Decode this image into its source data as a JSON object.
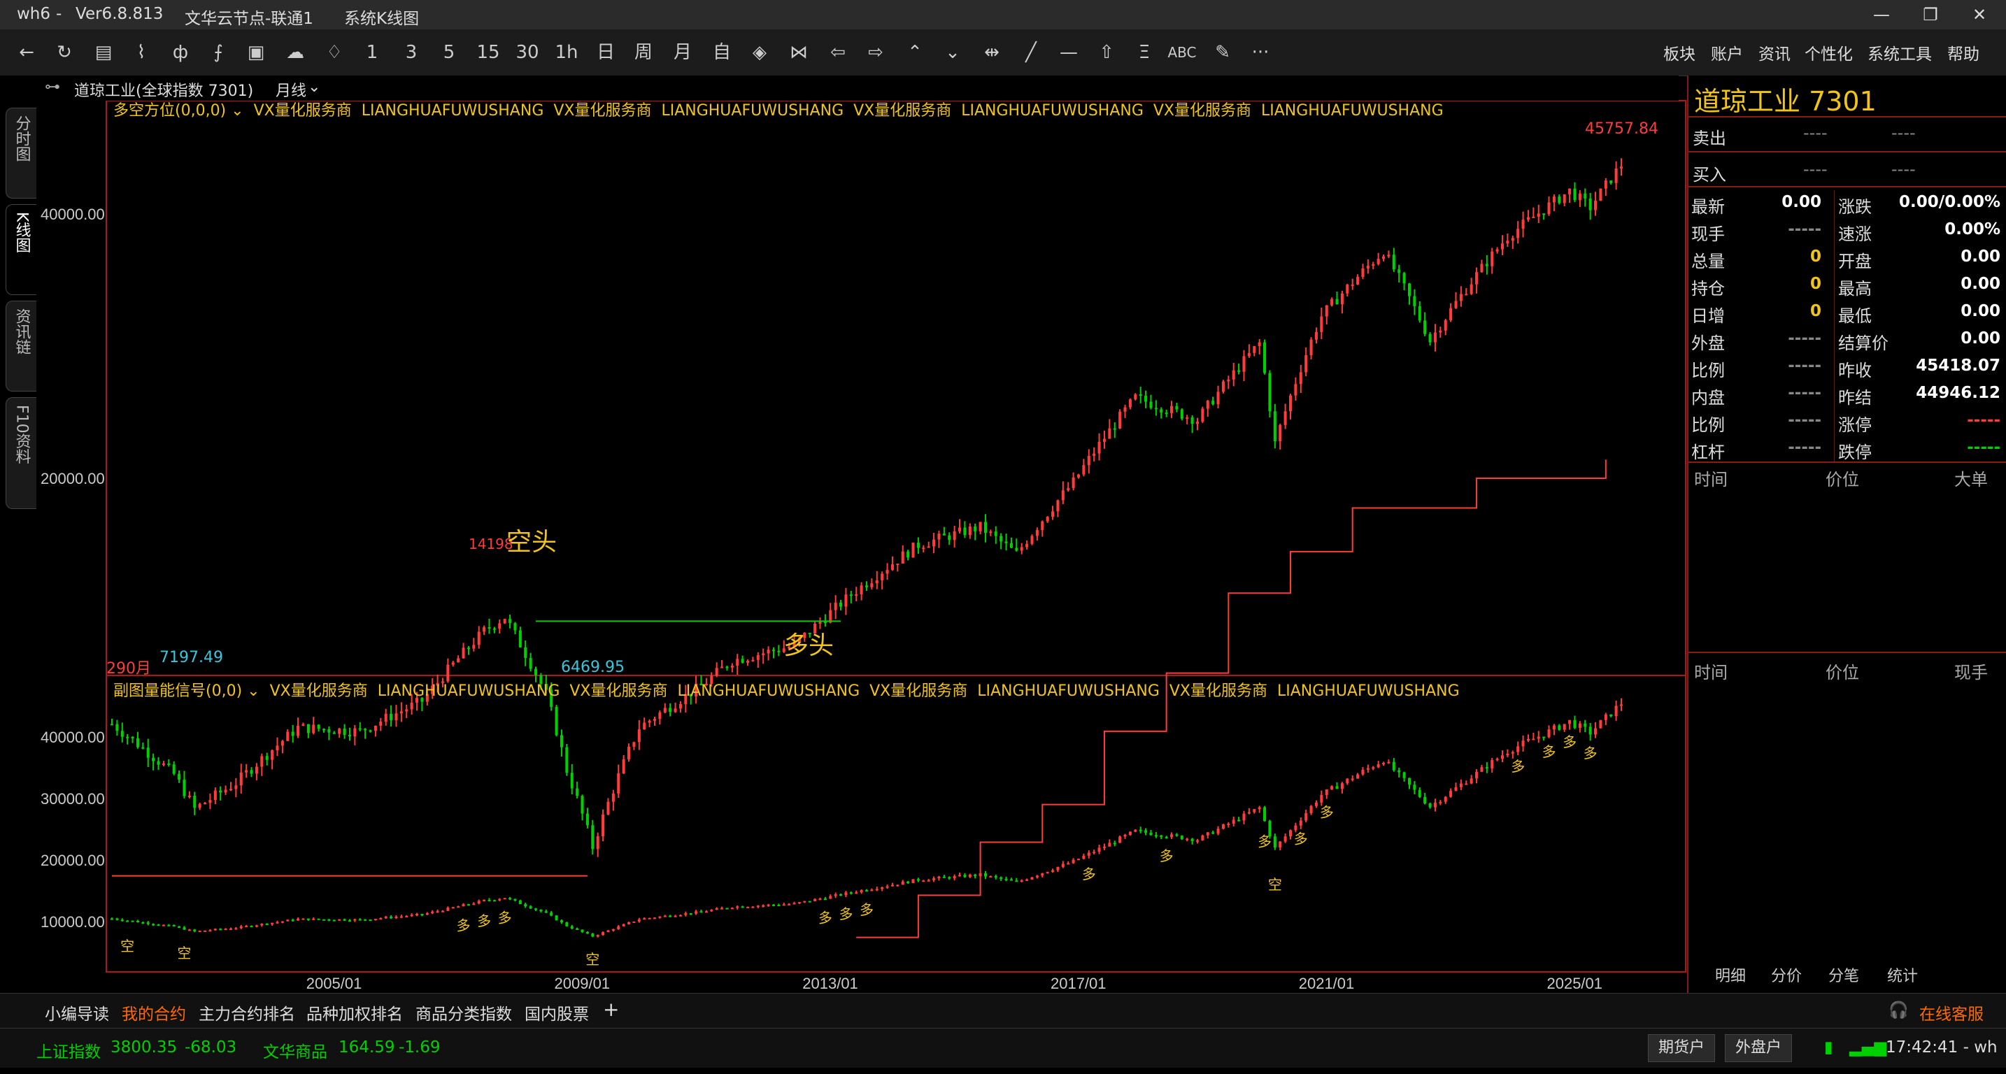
{
  "window": {
    "app": "wh6",
    "dash": "-",
    "version": "Ver6.8.813",
    "server": "文华云节点-联通1",
    "view": "系统K线图"
  },
  "toolbar": {
    "icons": [
      "back-icon",
      "refresh-icon",
      "list-icon",
      "line-chart-icon",
      "candlestick-icon",
      "indicator-icon",
      "board-icon",
      "cloud-icon",
      "bell-icon"
    ],
    "periods": [
      "1",
      "3",
      "5",
      "15",
      "30",
      "1h",
      "日",
      "周",
      "月",
      "自"
    ],
    "menu": [
      "板块",
      "账户",
      "资讯",
      "个性化",
      "系统工具",
      "帮助"
    ],
    "more": "···",
    "abc": "ABC"
  },
  "symbol_bar": {
    "name": "道琼工业(全球指数 7301)",
    "period": "月线"
  },
  "left_tabs": [
    "分时图",
    "K线图",
    "资讯链",
    "F10资料"
  ],
  "main_chart": {
    "indicator": "多空方位(0,0,0)",
    "ad_1": "VX量化服务商",
    "ad_2": "LIANGHUAFUWUSHANG",
    "high_label": "45757.84",
    "low_label_1": "7197.49",
    "low_label_2": "6469.95",
    "peak_label": "14198",
    "bars_label": "290月",
    "bear_label": "空头",
    "bull_label": "多头",
    "y_ticks": [
      "40000.00",
      "20000.00"
    ]
  },
  "sub_chart": {
    "indicator": "副图量能信号(0,0)",
    "y_ticks": [
      "40000.00",
      "30000.00",
      "20000.00",
      "10000.00"
    ],
    "buy_mark": "多",
    "sell_mark": "空"
  },
  "x_ticks": [
    "2005/01",
    "2009/01",
    "2013/01",
    "2017/01",
    "2021/01",
    "2025/01"
  ],
  "quote_panel": {
    "title": "道琼工业  7301",
    "sell_label": "卖出",
    "buy_label": "买入",
    "dash": "----",
    "rows_left": [
      {
        "label": "最新",
        "value": "0.00"
      },
      {
        "label": "现手",
        "value": "-----"
      },
      {
        "label": "总量",
        "value": "0"
      },
      {
        "label": "持仓",
        "value": "0"
      },
      {
        "label": "日增",
        "value": "0"
      },
      {
        "label": "外盘",
        "value": "-----"
      },
      {
        "label": "比例",
        "value": "-----"
      },
      {
        "label": "内盘",
        "value": "-----"
      },
      {
        "label": "比例",
        "value": "-----"
      },
      {
        "label": "杠杆",
        "value": "-----"
      }
    ],
    "rows_right": [
      {
        "label": "涨跌",
        "value": "0.00/0.00%"
      },
      {
        "label": "速涨",
        "value": "0.00%"
      },
      {
        "label": "开盘",
        "value": "0.00"
      },
      {
        "label": "最高",
        "value": "0.00"
      },
      {
        "label": "最低",
        "value": "0.00"
      },
      {
        "label": "结算价",
        "value": "0.00"
      },
      {
        "label": "昨收",
        "value": "45418.07"
      },
      {
        "label": "昨结",
        "value": "44946.12"
      },
      {
        "label": "涨停",
        "value": "-----"
      },
      {
        "label": "跌停",
        "value": "-----"
      }
    ],
    "tick_headers_1": [
      "时间",
      "价位",
      "大单"
    ],
    "tick_headers_2": [
      "时间",
      "价位",
      "现手"
    ],
    "tabs": [
      "明细",
      "分价",
      "分笔",
      "统计"
    ]
  },
  "bottom_tabs": [
    "小编导读",
    "我的合约",
    "主力合约排名",
    "品种加权排名",
    "商品分类指数",
    "国内股票",
    "+"
  ],
  "online_service": "在线客服",
  "status": {
    "idx1_name": "上证指数",
    "idx1_val": "3800.35",
    "idx1_chg": "-68.03",
    "idx2_name": "文华商品",
    "idx2_val": "164.59",
    "idx2_chg": "-1.69",
    "btn_futures": "期货户",
    "btn_outer": "外盘户",
    "time": "17:42:41 - wh"
  },
  "colors": {
    "up": "#ff3b3b",
    "down": "#00d000",
    "axis": "#b01818",
    "label_yellow": "#f0c419",
    "cyan": "#3cc6d9"
  },
  "chart_data": {
    "type": "candlestick",
    "title": "道琼工业(全球指数 7301)",
    "period": "月线",
    "x_range": [
      "2001/06",
      "2025/10"
    ],
    "y_range": [
      6000,
      47000
    ],
    "notable_points": [
      {
        "label": "7197.49",
        "type": "low",
        "date": "2002/10"
      },
      {
        "label": "14198",
        "type": "high",
        "date": "2007/10"
      },
      {
        "label": "6469.95",
        "type": "low",
        "date": "2009/03"
      },
      {
        "label": "45757.84",
        "type": "high",
        "date": "2025/10"
      }
    ],
    "close_path": [
      {
        "date": "2001/06",
        "close": 10500
      },
      {
        "date": "2002/06",
        "close": 9200
      },
      {
        "date": "2002/10",
        "close": 8400
      },
      {
        "date": "2003/06",
        "close": 9000
      },
      {
        "date": "2004/06",
        "close": 10400
      },
      {
        "date": "2005/06",
        "close": 10300
      },
      {
        "date": "2006/06",
        "close": 11150
      },
      {
        "date": "2007/06",
        "close": 13400
      },
      {
        "date": "2007/10",
        "close": 13900
      },
      {
        "date": "2008/06",
        "close": 11350
      },
      {
        "date": "2008/10",
        "close": 9300
      },
      {
        "date": "2009/03",
        "close": 7600
      },
      {
        "date": "2009/12",
        "close": 10400
      },
      {
        "date": "2010/12",
        "close": 11600
      },
      {
        "date": "2011/06",
        "close": 12400
      },
      {
        "date": "2012/06",
        "close": 12900
      },
      {
        "date": "2013/06",
        "close": 14900
      },
      {
        "date": "2014/06",
        "close": 16800
      },
      {
        "date": "2015/06",
        "close": 17600
      },
      {
        "date": "2016/01",
        "close": 16400
      },
      {
        "date": "2016/12",
        "close": 19800
      },
      {
        "date": "2017/12",
        "close": 24700
      },
      {
        "date": "2018/12",
        "close": 23300
      },
      {
        "date": "2019/12",
        "close": 28500
      },
      {
        "date": "2020/03",
        "close": 21900
      },
      {
        "date": "2020/12",
        "close": 30600
      },
      {
        "date": "2021/12",
        "close": 36300
      },
      {
        "date": "2022/09",
        "close": 28700
      },
      {
        "date": "2023/12",
        "close": 37700
      },
      {
        "date": "2024/12",
        "close": 42500
      },
      {
        "date": "2025/04",
        "close": 40700
      },
      {
        "date": "2025/10",
        "close": 45500
      }
    ]
  }
}
